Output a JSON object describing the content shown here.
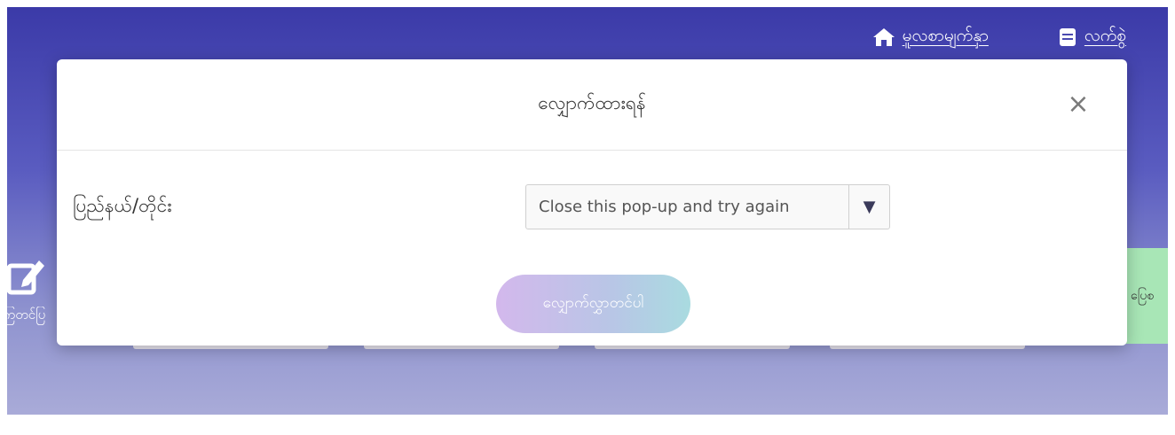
{
  "nav": {
    "home": {
      "label": "မူလစာမျက်နှာ",
      "icon": "home-icon"
    },
    "guide": {
      "label": "လက်စွဲ",
      "icon": "book-icon"
    }
  },
  "background": {
    "left_card_text": "ကြတင်ပြ",
    "left_card_icon": "edit-icon",
    "right_card_text": "ပြေစ",
    "right_card_color": "#a8e6b6"
  },
  "modal": {
    "title": "လျှောက်ထားရန်",
    "close_symbol": "×",
    "field_label": "ပြည်နယ်/တိုင်း",
    "select": {
      "value": "Close this pop-up and try again",
      "arrow": "▼"
    },
    "submit_label": "လျှောက်လွှာတင်ပါ"
  },
  "colors": {
    "header_gradient_top": "#3b3aa8",
    "header_gradient_bottom": "#a9abd8"
  }
}
